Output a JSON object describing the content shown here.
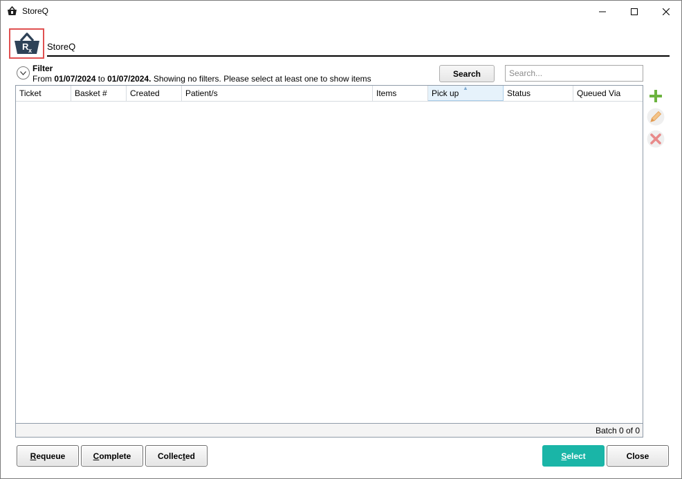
{
  "window": {
    "title": "StoreQ",
    "icon": "basket-rx-icon"
  },
  "header": {
    "logo_icon": "basket-rx-icon",
    "heading": "StoreQ"
  },
  "filter": {
    "title": "Filter",
    "desc_prefix": "From ",
    "from_date": "01/07/2024",
    "desc_to": " to ",
    "to_date": "01/07/2024.",
    "desc_suffix": " Showing no filters. Please select at least one to show items"
  },
  "search": {
    "button_label": "Search",
    "placeholder": "Search..."
  },
  "grid": {
    "columns": [
      "Ticket",
      "Basket #",
      "Created",
      "Patient/s",
      "Items",
      "Pick up",
      "Status",
      "Queued Via"
    ],
    "sorted_column": "Pick up",
    "rows": [],
    "footer": "Batch 0 of 0"
  },
  "tools": {
    "add_icon": "plus-icon",
    "edit_icon": "pencil-icon",
    "delete_icon": "delete-x-icon"
  },
  "buttons": {
    "requeue": {
      "pre": "",
      "ul": "R",
      "post": "equeue"
    },
    "complete": {
      "pre": "",
      "ul": "C",
      "post": "omplete"
    },
    "collected": {
      "pre": "Collec",
      "ul": "t",
      "post": "ed"
    },
    "select": {
      "pre": "",
      "ul": "S",
      "post": "elect"
    },
    "close": {
      "pre": "Close",
      "ul": "",
      "post": ""
    }
  },
  "colors": {
    "accent": "#1ab5a7",
    "logo": "#2e4257",
    "highlight_border": "#e05050",
    "add_icon": "#6cb33f",
    "edit_icon": "#f0b870",
    "delete_icon": "#e88a8a"
  }
}
